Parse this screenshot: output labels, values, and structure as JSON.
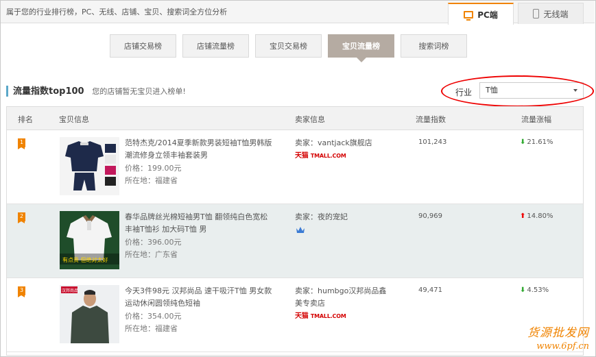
{
  "topbar": {
    "desc": "属于您的行业排行榜，PC、无线、店铺、宝贝、搜索词全方位分析"
  },
  "device_tabs": {
    "pc": "PC端",
    "mobile": "无线端"
  },
  "rank_tabs": [
    "店铺交易榜",
    "店铺流量榜",
    "宝贝交易榜",
    "宝贝流量榜",
    "搜索词榜"
  ],
  "section": {
    "title": "流量指数top100",
    "note": "您的店铺暂无宝贝进入榜单!"
  },
  "filter": {
    "label": "行业",
    "value": "T恤"
  },
  "table": {
    "headers": {
      "rank": "排名",
      "product": "宝贝信息",
      "seller": "卖家信息",
      "index": "流量指数",
      "change": "流量涨幅"
    },
    "rows": [
      {
        "rank": "1",
        "name": "范特杰克/2014夏季新款男装短袖T恤男韩版潮流修身立领丰袖套装男",
        "price": "价格：199.00元",
        "location": "所在地：福建省",
        "seller": "卖家：vantjack旗舰店",
        "platform": "天猫",
        "platform_en": "TMALL.COM",
        "index": "101,243",
        "change": "21.61%",
        "direction": "down"
      },
      {
        "rank": "2",
        "name": "春华品牌丝光棉短袖男T恤 翻领纯白色宽松丰袖T恤衫 加大码T恤 男",
        "price": "价格：396.00元",
        "location": "所在地：广东省",
        "seller": "卖家：夜的宠妃",
        "platform": "",
        "platform_en": "",
        "index": "90,969",
        "change": "14.80%",
        "direction": "up"
      },
      {
        "rank": "3",
        "name": "今天3件98元 汉邦尚品 速干吸汗T恤 男女款运动休闲圆领纯色短袖",
        "price": "价格：354.00元",
        "location": "所在地：福建省",
        "seller": "卖家：humbgo汉邦尚品鑫美专卖店",
        "platform": "天猫",
        "platform_en": "TMALL.COM",
        "index": "49,471",
        "change": "4.53%",
        "direction": "down"
      }
    ]
  },
  "thumb_text": {
    "row2_caption": "有点贵 但绝对太好",
    "row3_logo": "汉邦尚品"
  },
  "watermark": {
    "line1": "货源批发网",
    "line2": "www.6pf.cn"
  },
  "colors": {
    "accent": "#f08300",
    "active_tab": "#b5aba2",
    "tmall_red": "#d40000",
    "up": "#ee0000",
    "down": "#33aa33"
  }
}
